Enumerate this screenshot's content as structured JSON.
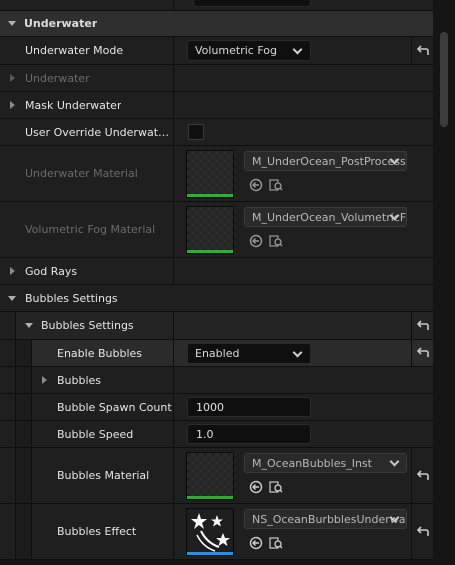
{
  "sections": {
    "underwater": {
      "title": "Underwater"
    },
    "bubbles_settings": {
      "title": "Bubbles Settings"
    },
    "bubbles_settings_sub": {
      "title": "Bubbles Settings"
    }
  },
  "properties": {
    "underwater_mode": {
      "label": "Underwater Mode",
      "value": "Volumetric Fog"
    },
    "underwater_group": {
      "label": "Underwater"
    },
    "mask_underwater": {
      "label": "Mask Underwater"
    },
    "user_override": {
      "label": "User Override Underwater..."
    },
    "underwater_material": {
      "label": "Underwater Material",
      "asset": "M_UnderOcean_PostProcess"
    },
    "volumetric_fog_material": {
      "label": "Volumetric Fog Material",
      "asset": "M_UnderOcean_VolumetricFog"
    },
    "god_rays": {
      "label": "God Rays"
    },
    "enable_bubbles": {
      "label": "Enable Bubbles",
      "value": "Enabled"
    },
    "bubbles_group": {
      "label": "Bubbles"
    },
    "bubble_spawn_count": {
      "label": "Bubble Spawn Count",
      "value": "1000"
    },
    "bubble_speed": {
      "label": "Bubble Speed",
      "value": "1.0"
    },
    "bubbles_material": {
      "label": "Bubbles Material",
      "asset": "M_OceanBubbles_Inst"
    },
    "bubbles_effect": {
      "label": "Bubbles Effect",
      "asset": "NS_OceanBurbblesUnderwater"
    }
  },
  "colors": {
    "accent_green": "#3aa53a",
    "accent_blue": "#2d8fe0",
    "panel_bg": "#151515"
  },
  "icons": {
    "reset": "reset-arrow-icon",
    "use_selected": "use-selected-arrow-icon",
    "browse": "browse-asset-icon"
  }
}
